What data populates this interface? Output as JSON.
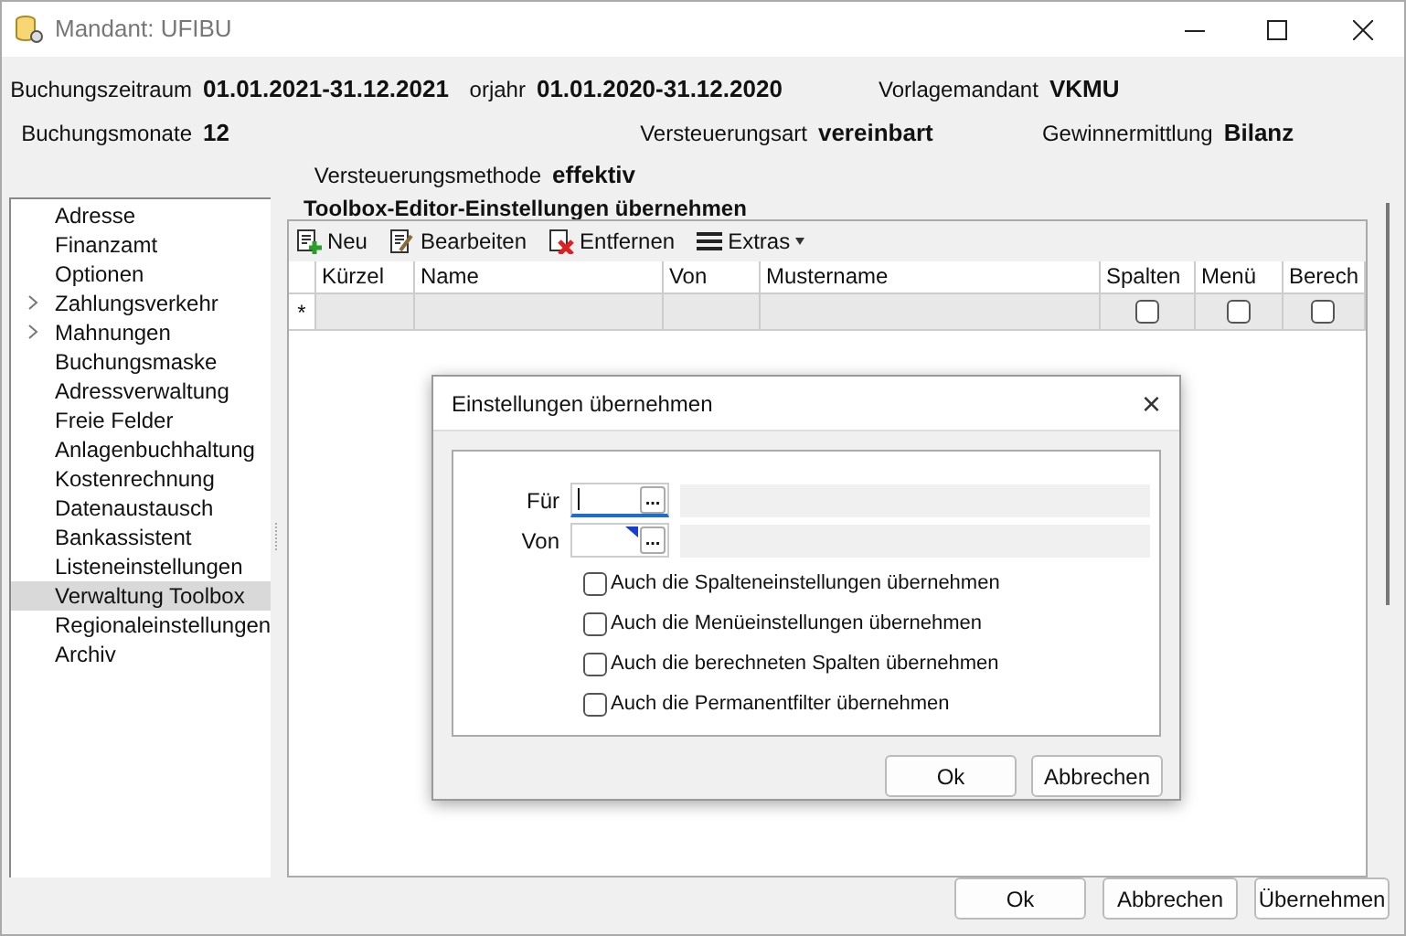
{
  "window": {
    "title": "Mandant: UFIBU"
  },
  "info": [
    {
      "label": "Buchungszeitraum",
      "value": "01.01.2021-31.12.2021"
    },
    {
      "label": "orjahr",
      "value": "01.01.2020-31.12.2020"
    },
    {
      "label": "Vorlagemandant",
      "value": "VKMU"
    },
    {
      "label": "Buchungsmonate",
      "value": "12"
    },
    {
      "label": "Versteuerungsart",
      "value": "vereinbart"
    },
    {
      "label": "Gewinnermittlung",
      "value": "Bilanz"
    },
    {
      "label": "Versteuerungsmethode",
      "value": "effektiv"
    }
  ],
  "sidebar": {
    "items": [
      {
        "label": "Adresse",
        "expandable": false,
        "selected": false
      },
      {
        "label": "Finanzamt",
        "expandable": false,
        "selected": false
      },
      {
        "label": "Optionen",
        "expandable": false,
        "selected": false
      },
      {
        "label": "Zahlungsverkehr",
        "expandable": true,
        "selected": false
      },
      {
        "label": "Mahnungen",
        "expandable": true,
        "selected": false
      },
      {
        "label": "Buchungsmaske",
        "expandable": false,
        "selected": false
      },
      {
        "label": "Adressverwaltung",
        "expandable": false,
        "selected": false
      },
      {
        "label": "Freie Felder",
        "expandable": false,
        "selected": false
      },
      {
        "label": "Anlagenbuchhaltung",
        "expandable": false,
        "selected": false
      },
      {
        "label": "Kostenrechnung",
        "expandable": false,
        "selected": false
      },
      {
        "label": "Datenaustausch",
        "expandable": false,
        "selected": false
      },
      {
        "label": "Bankassistent",
        "expandable": false,
        "selected": false
      },
      {
        "label": "Listeneinstellungen",
        "expandable": false,
        "selected": false
      },
      {
        "label": "Verwaltung Toolbox",
        "expandable": false,
        "selected": true
      },
      {
        "label": "Regionaleinstellungen",
        "expandable": false,
        "selected": false
      },
      {
        "label": "Archiv",
        "expandable": false,
        "selected": false
      }
    ]
  },
  "group": {
    "title": "Toolbox-Editor-Einstellungen übernehmen"
  },
  "toolbar": [
    {
      "kind": "new",
      "label": "Neu"
    },
    {
      "kind": "edit",
      "label": "Bearbeiten"
    },
    {
      "kind": "delete",
      "label": "Entfernen"
    },
    {
      "kind": "menu",
      "label": "Extras"
    }
  ],
  "table": {
    "columns": [
      {
        "label": "Kürzel",
        "kind": "text"
      },
      {
        "label": "Name",
        "kind": "text"
      },
      {
        "label": "Von",
        "kind": "text"
      },
      {
        "label": "Mustername",
        "kind": "text"
      },
      {
        "label": "Spalten",
        "kind": "check"
      },
      {
        "label": "Menü",
        "kind": "check"
      },
      {
        "label": "Berech",
        "kind": "check"
      }
    ],
    "new_row": {
      "marker": "*",
      "checks": [
        false,
        false,
        false
      ]
    }
  },
  "dialog": {
    "title": "Einstellungen übernehmen",
    "close": "×",
    "fields": [
      {
        "label": "Für",
        "focused": true,
        "button": "..."
      },
      {
        "label": "Von",
        "focused": false,
        "button": "..."
      }
    ],
    "options": [
      {
        "label": "Auch die Spalteneinstellungen übernehmen",
        "checked": false
      },
      {
        "label": "Auch die Menüeinstellungen übernehmen",
        "checked": false
      },
      {
        "label": "Auch die berechneten Spalten übernehmen",
        "checked": false
      },
      {
        "label": "Auch die Permanentfilter übernehmen",
        "checked": false
      }
    ],
    "buttons": [
      "Ok",
      "Abbrechen"
    ]
  },
  "buttons": [
    "Ok",
    "Abbrechen",
    "Übernehmen"
  ]
}
